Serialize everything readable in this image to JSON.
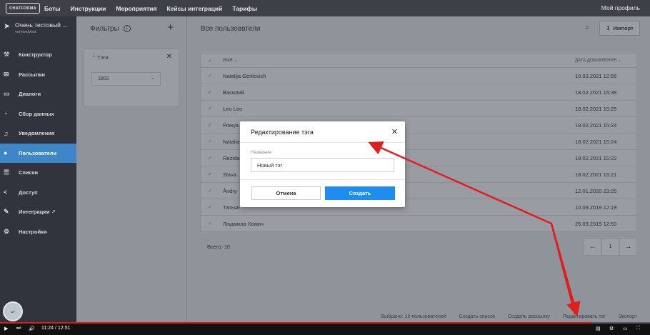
{
  "topbar": {
    "logo": "CHATFORMA",
    "nav": [
      "Боты",
      "Инструкции",
      "Мероприятия",
      "Кейсы интеграций",
      "Тарифы"
    ],
    "profile": "Мой профиль"
  },
  "sidebar": {
    "bot_name": "Очень тестовый ...",
    "bot_sub": "verytestybot",
    "items": [
      {
        "label": "Конструктор",
        "icon": "wrench-icon"
      },
      {
        "label": "Рассылки",
        "icon": "mail-icon"
      },
      {
        "label": "Диалоги",
        "icon": "chat-icon"
      },
      {
        "label": "Сбор данных",
        "icon": "data-icon"
      },
      {
        "label": "Уведомления",
        "icon": "bell-icon"
      },
      {
        "label": "Пользователи",
        "icon": "users-icon"
      },
      {
        "label": "Списки",
        "icon": "list-icon"
      },
      {
        "label": "Доступ",
        "icon": "share-icon"
      },
      {
        "label": "Интеграции",
        "icon": "puzzle-icon"
      },
      {
        "label": "Настройки",
        "icon": "gear-icon"
      }
    ],
    "active_index": 5
  },
  "filters": {
    "title": "Фильтры",
    "tag_title": "Тэги",
    "tag_value": "1802"
  },
  "main": {
    "title": "Все пользователи",
    "import_label": "Импорт",
    "col_name": "ИМЯ",
    "col_date": "ДАТА ДОБАВЛЕНИЯ",
    "rows": [
      {
        "name": "Natalija Gerilovich",
        "date": "10.03.2021 12:56"
      },
      {
        "name": "Василий",
        "date": "18.02.2021 15:38"
      },
      {
        "name": "Leo Leo",
        "date": "18.02.2021 15:25"
      },
      {
        "name": "Ромуа",
        "date": "18.02.2021 15:24"
      },
      {
        "name": "Natalia",
        "date": "18.02.2021 15:24"
      },
      {
        "name": "Rezida",
        "date": "18.02.2021 15:22"
      },
      {
        "name": "Slava",
        "date": "18.02.2021 15:21"
      },
      {
        "name": "Ândry",
        "date": "12.01.2020 23:25"
      },
      {
        "name": "Татьян",
        "date": "10.09.2019 12:19"
      },
      {
        "name": "Людмила Хомич",
        "date": "25.03.2019 12:50"
      }
    ],
    "total": "Всего: 10",
    "page": "1",
    "bottom_actions": [
      "Выбрано: 10 пользователей",
      "Создать список",
      "Создать рассылку",
      "Редактировать тэг",
      "Экспорт"
    ]
  },
  "modal": {
    "title": "Редактирование тэга",
    "field_label": "Название",
    "field_value": "Новый тэг",
    "cancel": "Отмена",
    "create": "Создать"
  },
  "player": {
    "time": "11:24 / 12:51"
  },
  "colors": {
    "accent": "#1d8ef0",
    "active_menu": "#3f86c9",
    "annotation": "#e11d1d"
  }
}
